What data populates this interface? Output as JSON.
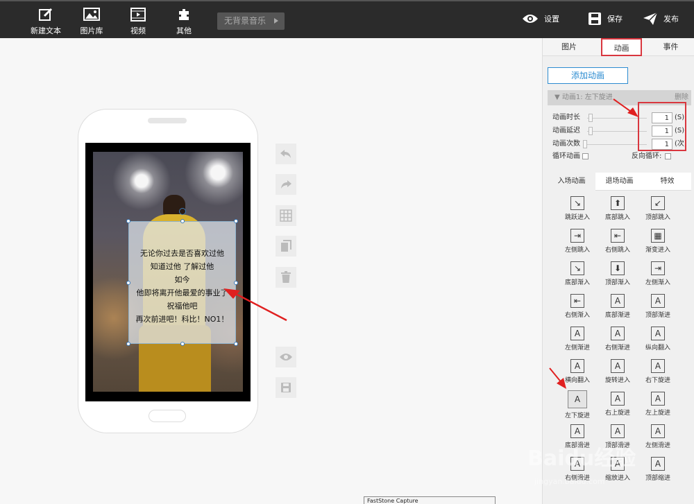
{
  "toolbar": {
    "new_text": "新建文本",
    "gallery": "图片库",
    "video": "视频",
    "other": "其他",
    "music": "无背景音乐",
    "settings": "设置",
    "save": "保存",
    "publish": "发布"
  },
  "textbox": {
    "lines": [
      "无论你过去是否喜欢过他",
      "知道过他   了解过他",
      "如今",
      "他即将离开他最爱的事业了",
      "祝福他吧",
      "再次前进吧！科比！NO1！"
    ]
  },
  "panel": {
    "tabs": [
      "图片",
      "动画",
      "事件"
    ],
    "add_animation": "添加动画",
    "anim_title": "▼ 动画1: 左下旋进",
    "delete": "删除",
    "params": [
      {
        "label": "动画时长",
        "value": "1",
        "unit": "(S)"
      },
      {
        "label": "动画延迟",
        "value": "1",
        "unit": "(S)"
      },
      {
        "label": "动画次数",
        "value": "1",
        "unit": "(次)"
      }
    ],
    "loop": "循环动画",
    "reverse": "反向循环:",
    "subtabs": [
      "入场动画",
      "退场动画",
      "特效"
    ],
    "effects": [
      "跳跃进入",
      "底部跳入",
      "顶部跳入",
      "左侧跳入",
      "右侧跳入",
      "渐变进入",
      "底部渐入",
      "顶部渐入",
      "左侧渐入",
      "右侧渐入",
      "底部渐进",
      "顶部渐进",
      "左侧渐进",
      "右侧渐进",
      "纵向翻入",
      "横向翻入",
      "旋转进入",
      "右下旋进",
      "左下旋进",
      "右上旋进",
      "左上旋进",
      "底部滑进",
      "顶部滑进",
      "左侧滑进",
      "右侧滑进",
      "缩放进入",
      "顶部缩进"
    ],
    "selected_effect": "左下旋进"
  },
  "taskbar": {
    "faststone": "FastStone Capture"
  },
  "watermark": {
    "logo": "Baidu经验",
    "url": "jingyan.baidu.com"
  }
}
